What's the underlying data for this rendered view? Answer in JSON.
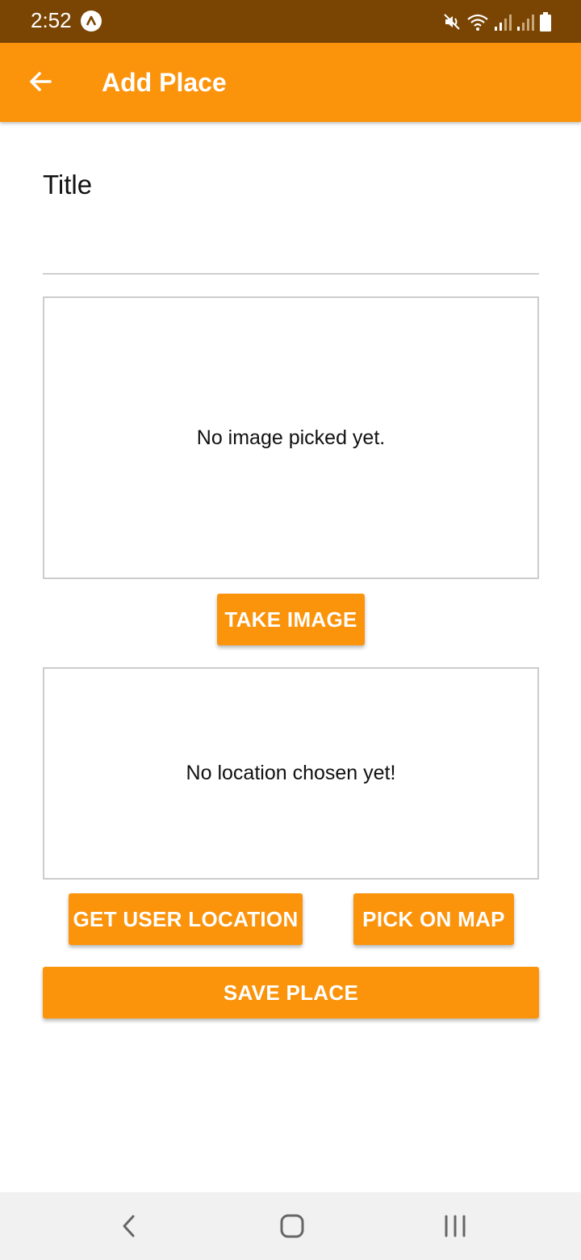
{
  "status_bar": {
    "time": "2:52",
    "icons": [
      "app-notification-icon",
      "mute-icon",
      "wifi-icon",
      "signal-icon",
      "signal-icon",
      "battery-icon"
    ],
    "background_color": "#7a4503"
  },
  "app_bar": {
    "title": "Add Place",
    "back_icon": "arrow-left-icon",
    "color": "#fb930b"
  },
  "form": {
    "title_label": "Title",
    "title_value": ""
  },
  "image_picker": {
    "placeholder_text": "No image picked yet.",
    "take_image_label": "TAKE IMAGE"
  },
  "location_picker": {
    "placeholder_text": "No location chosen yet!",
    "get_user_location_label": "GET USER LOCATION",
    "pick_on_map_label": "PICK ON MAP"
  },
  "actions": {
    "save_label": "SAVE PLACE"
  },
  "nav_bar": {
    "icons": [
      "nav-back-icon",
      "nav-home-icon",
      "nav-recent-apps-icon"
    ]
  },
  "colors": {
    "accent": "#fb930b",
    "status_bar": "#7a4503",
    "border": "#cccccc"
  }
}
